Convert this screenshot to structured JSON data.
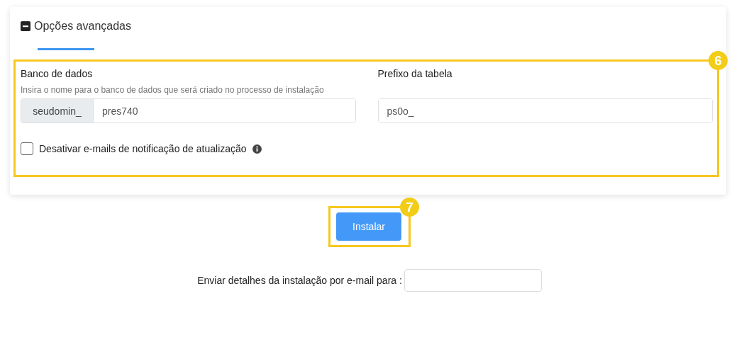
{
  "section": {
    "title": "Opções avançadas",
    "expanded": true
  },
  "callouts": [
    {
      "label": "6"
    },
    {
      "label": "7"
    }
  ],
  "database": {
    "label": "Banco de dados",
    "hint": "Insira o nome para o banco de dados que será criado no processo de instalação",
    "prefix": "seudomin_",
    "value": "pres740"
  },
  "table_prefix": {
    "label": "Prefixo da tabela",
    "value": "ps0o_"
  },
  "disable_update_emails": {
    "label": "Desativar e-mails de notificação de atualização",
    "checked": false
  },
  "install_button": "Instalar",
  "email_details": {
    "label": "Enviar detalhes da instalação por e-mail para :"
  }
}
